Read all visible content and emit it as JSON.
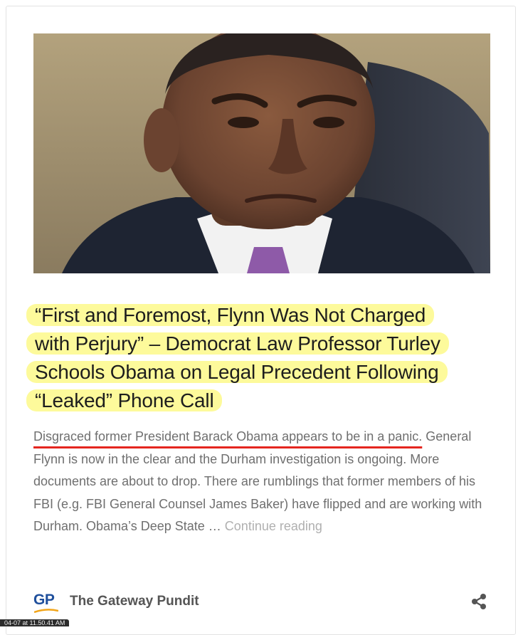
{
  "article": {
    "headline_lines": [
      "“First and Foremost, Flynn Was Not Charged",
      "with Perjury” – Democrat Law Professor Turley",
      "Schools Obama on Legal Precedent Following",
      "“Leaked” Phone Call"
    ],
    "excerpt_lead": "Disgraced former President Barack Obama appears to be in a panic.",
    "excerpt_body": " General Flynn is now in the clear and the Durham investigation is ongoing. More documents are about to drop. There are rumblings that former members of his FBI (e.g. FBI General Counsel James Baker) have flipped and are working with Durham.  Obama’s Deep State … ",
    "continue_label": "Continue reading"
  },
  "source": {
    "logo_text": "GP",
    "name": "The Gateway Pundit"
  },
  "icons": {
    "share": "share-icon"
  },
  "timestamp": "04-07 at 11.50.41 AM",
  "colors": {
    "highlight": "#fdfa9b",
    "underline": "#e5261f",
    "logo_blue": "#1f4f9c",
    "logo_orange": "#f2a51a"
  }
}
